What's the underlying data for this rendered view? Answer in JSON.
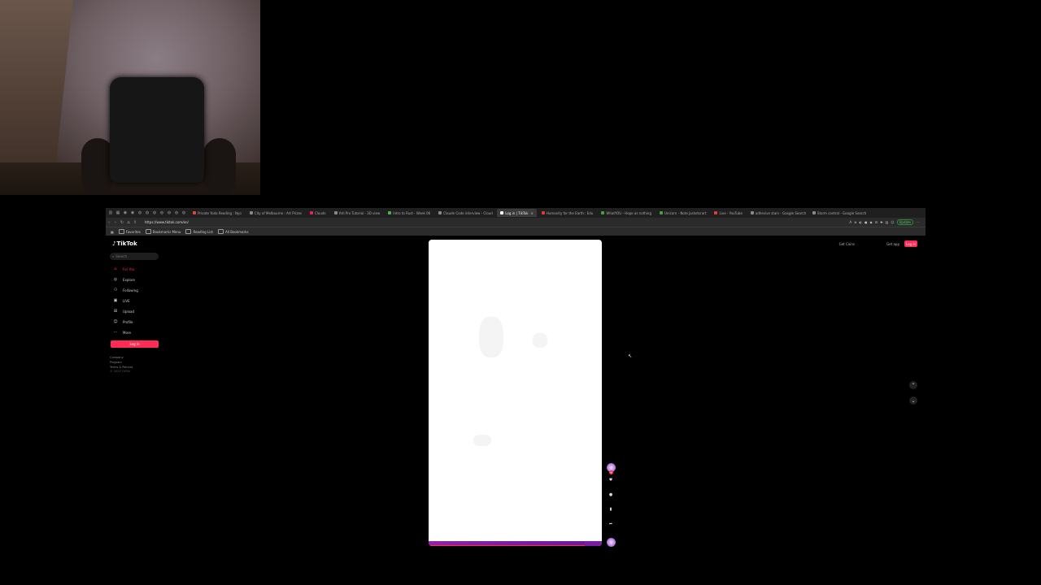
{
  "webcam": {
    "label": ""
  },
  "browser": {
    "tabs": [
      {
        "title": "Private Yoda Reading : Nyo",
        "color": "#ea4335",
        "active": false
      },
      {
        "title": "City of Melbourne : Art Prizes",
        "color": "#888888",
        "active": false
      },
      {
        "title": "Clouds",
        "color": "#e91e63",
        "active": false
      },
      {
        "title": "Yeti Pro Tutorial - 3D view",
        "color": "#888888",
        "active": false
      },
      {
        "title": "Intro to Rust - Week 06",
        "color": "#4caf50",
        "active": false
      },
      {
        "title": "Claude Code interview - Cloud",
        "color": "#888888",
        "active": false
      },
      {
        "title": "Log in | TikTok",
        "color": "#ffffff",
        "active": true
      },
      {
        "title": "Humanity for the Earth : Edu",
        "color": "#e53935",
        "active": false
      },
      {
        "title": "WhatYOU - Hope as nothing",
        "color": "#43a047",
        "active": false
      },
      {
        "title": "Unicorn - Note Jacketsrart",
        "color": "#43a047",
        "active": false
      },
      {
        "title": "Live - YouTube",
        "color": "#e53935",
        "active": false
      },
      {
        "title": "adhesive stars - Google Search",
        "color": "#888888",
        "active": false
      },
      {
        "title": "Storm control - Google Search",
        "color": "#888888",
        "active": false
      }
    ],
    "tab_close": "×",
    "url": "https://www.tiktok.com/en/",
    "update_label": "Update",
    "bookmarks": [
      {
        "label": "Favorites"
      },
      {
        "label": "Bookmarks Menu"
      },
      {
        "label": "Reading List"
      }
    ],
    "all_bookmarks": "All Bookmarks"
  },
  "tiktok": {
    "logo": "TikTok",
    "search_placeholder": "Search",
    "nav": [
      {
        "label": "For You",
        "icon": "home-icon",
        "glyph": "⌂",
        "active": true
      },
      {
        "label": "Explore",
        "icon": "compass-icon",
        "glyph": "◎",
        "active": false
      },
      {
        "label": "Following",
        "icon": "people-icon",
        "glyph": "⚇",
        "active": false
      },
      {
        "label": "LIVE",
        "icon": "live-icon",
        "glyph": "▣",
        "active": false
      },
      {
        "label": "Upload",
        "icon": "upload-icon",
        "glyph": "⊞",
        "active": false
      },
      {
        "label": "Profile",
        "icon": "profile-icon",
        "glyph": "☺",
        "active": false
      },
      {
        "label": "More",
        "icon": "more-icon",
        "glyph": "⋯",
        "active": false
      }
    ],
    "login_sidebar": "Log in",
    "footer": [
      "Company",
      "Program",
      "Terms & Policies",
      "© 2024 TikTok"
    ],
    "get_coins": "Get Coins",
    "get_app": "Get app",
    "login_top": "Log in",
    "video": {
      "caption": "",
      "author": "",
      "progress_fraction": 0.9
    },
    "actions": [
      {
        "name": "like",
        "glyph": "♥",
        "count": ""
      },
      {
        "name": "comment",
        "glyph": "●",
        "count": ""
      },
      {
        "name": "save",
        "glyph": "▮",
        "count": ""
      },
      {
        "name": "share",
        "glyph": "➦",
        "count": ""
      }
    ],
    "arrow_up": "⌃",
    "arrow_down": "⌄"
  }
}
